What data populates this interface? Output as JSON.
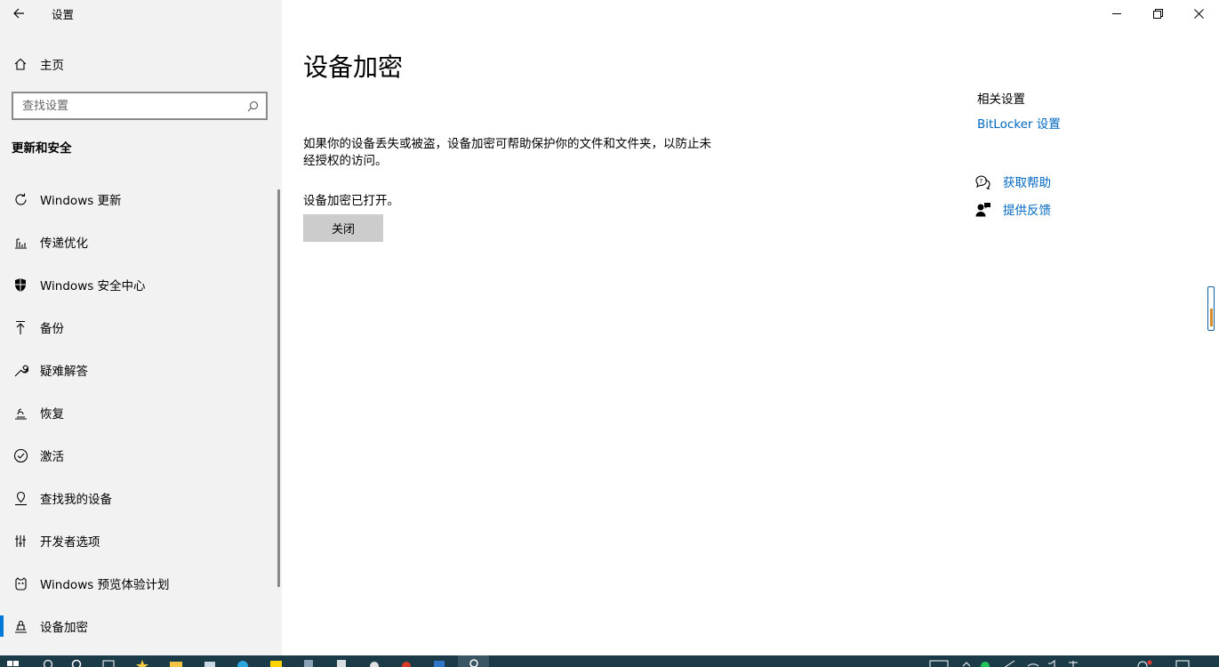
{
  "window": {
    "app_title": "设置",
    "controls": [
      "minimize",
      "restore",
      "close"
    ]
  },
  "sidebar": {
    "home_label": "主页",
    "search_placeholder": "查找设置",
    "section_heading": "更新和安全",
    "items": [
      {
        "label": "Windows 更新",
        "icon": "refresh-icon"
      },
      {
        "label": "传递优化",
        "icon": "delivery-optimization-icon"
      },
      {
        "label": "Windows 安全中心",
        "icon": "shield-icon"
      },
      {
        "label": "备份",
        "icon": "backup-arrow-icon"
      },
      {
        "label": "疑难解答",
        "icon": "wrench-icon"
      },
      {
        "label": "恢复",
        "icon": "recovery-icon"
      },
      {
        "label": "激活",
        "icon": "check-circle-icon"
      },
      {
        "label": "查找我的设备",
        "icon": "find-device-icon"
      },
      {
        "label": "开发者选项",
        "icon": "developer-icon"
      },
      {
        "label": "Windows 预览体验计划",
        "icon": "insider-icon"
      },
      {
        "label": "设备加密",
        "icon": "device-encryption-icon",
        "selected": true
      }
    ]
  },
  "main": {
    "title": "设备加密",
    "description": "如果你的设备丢失或被盗，设备加密可帮助保护你的文件和文件夹，以防止未经授权的访问。",
    "status": "设备加密已打开。",
    "button_label": "关闭"
  },
  "related": {
    "title": "相关设置",
    "link": "BitLocker 设置",
    "help_label": "获取帮助",
    "feedback_label": "提供反馈"
  },
  "colors": {
    "sidebar_bg": "#f2f2f2",
    "accent": "#0078d7",
    "link": "#0067c0",
    "button_bg": "#cccccc",
    "taskbar": "#1b3b48"
  }
}
